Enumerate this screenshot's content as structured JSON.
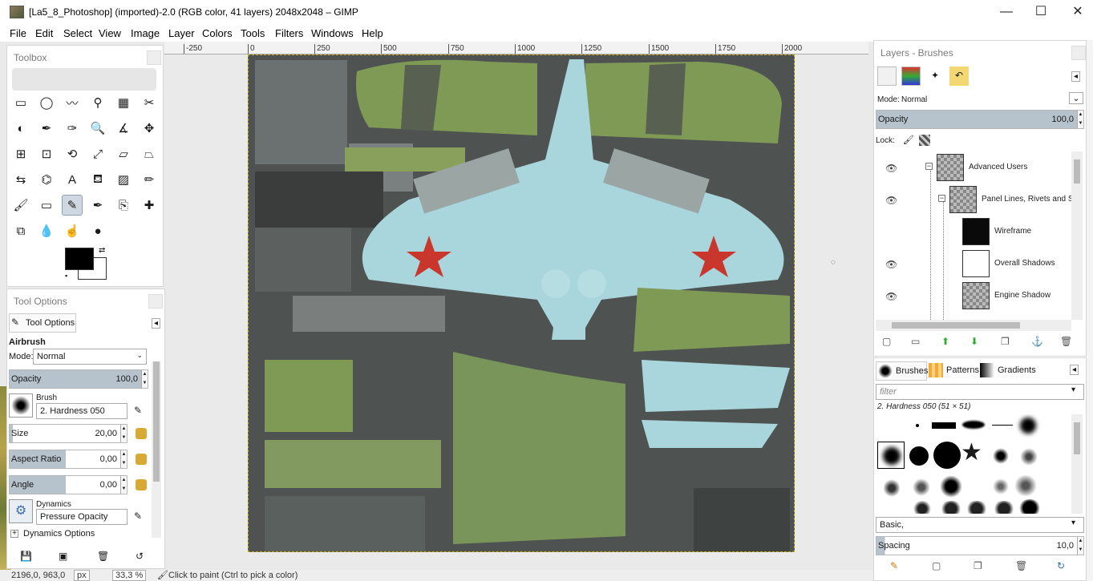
{
  "window": {
    "title": "[La5_8_Photoshop] (imported)-2.0 (RGB color, 41 layers) 2048x2048 – GIMP",
    "minimize": "—",
    "maximize": "☐",
    "close": "✕"
  },
  "menu": [
    "File",
    "Edit",
    "Select",
    "View",
    "Image",
    "Layer",
    "Colors",
    "Tools",
    "Filters",
    "Windows",
    "Help"
  ],
  "ruler": {
    "ticks": [
      "-250",
      "0",
      "250",
      "500",
      "750",
      "1000",
      "1250",
      "1500",
      "1750",
      "2000"
    ]
  },
  "toolbox": {
    "title": "Toolbox",
    "tools": [
      "rect-select",
      "ellipse-select",
      "free-select",
      "fuzzy-select",
      "select-by-color",
      "scissors",
      "foreground-select",
      "paths",
      "color-picker",
      "zoom",
      "measure",
      "move",
      "align",
      "crop",
      "rotate",
      "scale",
      "shear",
      "perspective",
      "flip",
      "cage",
      "text",
      "bucket-fill",
      "blend",
      "pencil",
      "paintbrush",
      "eraser",
      "airbrush",
      "ink",
      "clone",
      "heal",
      "perspective-clone",
      "blur",
      "smudge",
      "dodge-burn"
    ],
    "selected_tool": "airbrush"
  },
  "tool_options": {
    "title": "Tool Options",
    "tab_label": "Tool Options",
    "tool_name": "Airbrush",
    "mode_label": "Mode:",
    "mode_value": "Normal",
    "opacity_label": "Opacity",
    "opacity_value": "100,0",
    "brush_label": "Brush",
    "brush_value": "2. Hardness 050",
    "size_label": "Size",
    "size_value": "20,00",
    "aspect_label": "Aspect Ratio",
    "aspect_value": "0,00",
    "angle_label": "Angle",
    "angle_value": "0,00",
    "dynamics_label": "Dynamics",
    "dynamics_value": "Pressure Opacity",
    "dynamics_options": "Dynamics Options",
    "colors": {
      "foreground": "#000000",
      "background": "#ffffff"
    }
  },
  "status": {
    "coords": "2196,0, 963,0",
    "unit": "px",
    "zoom": "33,3 %",
    "message": "Click to paint (Ctrl to pick a color)"
  },
  "layers_panel": {
    "title": "Layers - Brushes",
    "mode_label": "Mode:",
    "mode_value": "Normal",
    "opacity_label": "Opacity",
    "opacity_value": "100,0",
    "lock_label": "Lock:",
    "layers": [
      {
        "name": "Advanced Users",
        "visible": true
      },
      {
        "name": "Panel Lines, Rivets and S",
        "visible": true
      },
      {
        "name": "Wireframe",
        "visible": false
      },
      {
        "name": "Overall Shadows",
        "visible": true
      },
      {
        "name": "Engine Shadow",
        "visible": true
      }
    ]
  },
  "brushes_panel": {
    "tabs": [
      "Brushes",
      "Patterns",
      "Gradients"
    ],
    "filter_placeholder": "filter",
    "selected_brush": "2. Hardness 050 (51 × 51)",
    "tag_value": "Basic,",
    "spacing_label": "Spacing",
    "spacing_value": "10,0"
  }
}
